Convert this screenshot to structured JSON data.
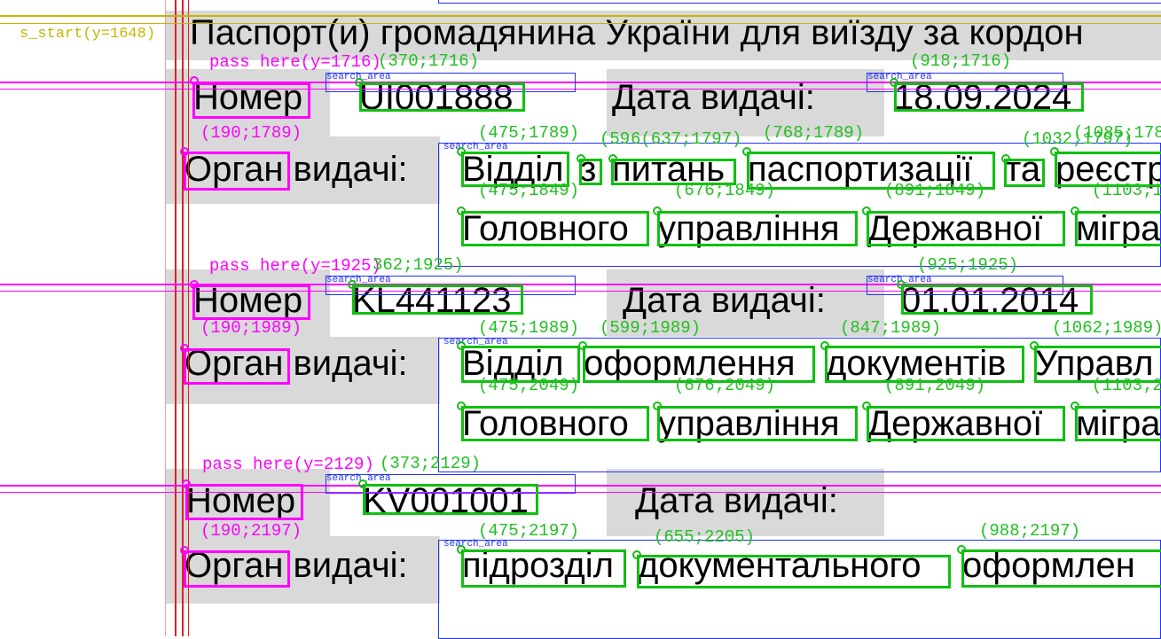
{
  "doc": {
    "heading": "Паспорт(и) громадянина України для виїзду за кордон",
    "number_label": "Номер",
    "issue_date_label": "Дата видачі:",
    "authority_label": "Орган видачі:"
  },
  "records": [
    {
      "number": "UI001888",
      "issue_date": "18.09.2024",
      "authority_line1": [
        "Відділ",
        "з",
        "питань",
        "паспортизації",
        "та",
        "реєстр"
      ],
      "authority_line2": [
        "Головного",
        "управління",
        "Державної",
        "мігра"
      ]
    },
    {
      "number": "KL441123",
      "issue_date": "01.01.2014",
      "authority_line1": [
        "Відділ",
        "оформлення",
        "документів",
        "Управл"
      ],
      "authority_line2": [
        "Головного",
        "управління",
        "Державної",
        "мігра"
      ]
    },
    {
      "number": "KV001001",
      "issue_date": "",
      "authority_line1": [
        "підрозділ",
        "документального",
        "оформлен"
      ]
    }
  ],
  "overlay": {
    "start_label": "s_start(y=1648)",
    "search_area_label": "search_area",
    "pass_labels": [
      "pass here(y=1716)",
      "pass here(y=1925)",
      "pass here(y=2129)"
    ],
    "coords": {
      "r1_number": "(370;1716)",
      "r1_date": "(918;1716)",
      "r1_label": "(190;1789)",
      "r1_l1_w1": "(475;1789)",
      "r1_l1_w2": "(59",
      "r1_l1_w2b": "6(637;1797)",
      "r1_l1_w3": "(768;1789)",
      "r1_l1_w4": "(1032;1797)",
      "r1_l1_w5": "(1085;178",
      "r1_l2_w1": "(475;1849)",
      "r1_l2_w2": "(676;1849)",
      "r1_l2_w3": "(891;1849)",
      "r1_l2_w4": "(1103;1",
      "r2_number": "362;1925)",
      "r2_date": "(925;1925)",
      "r2_label": "(190;1989)",
      "r2_l1_w1": "(475;1989)",
      "r2_l1_w2": "(599;1989)",
      "r2_l1_w3": "(847;1989)",
      "r2_l1_w4": "(1062;1989)",
      "r2_l2_w1": "(475;2049)",
      "r2_l2_w2": "(676;2049)",
      "r2_l2_w3": "(891;2049)",
      "r2_l2_w4": "(1103;2",
      "r3_number": "(373;2129)",
      "r3_label": "(190;2197)",
      "r3_l1_w1": "(475;2197)",
      "r3_l1_w2": "(655;2205)",
      "r3_l1_w3": "(988;2197)"
    }
  },
  "colors": {
    "word_box": "#10c010",
    "label_box": "#ff00ff",
    "search_area": "#2233ff",
    "guide_red": "#e02020",
    "guide_yellow": "#c8b400",
    "field_background": "#d9d9d9"
  }
}
